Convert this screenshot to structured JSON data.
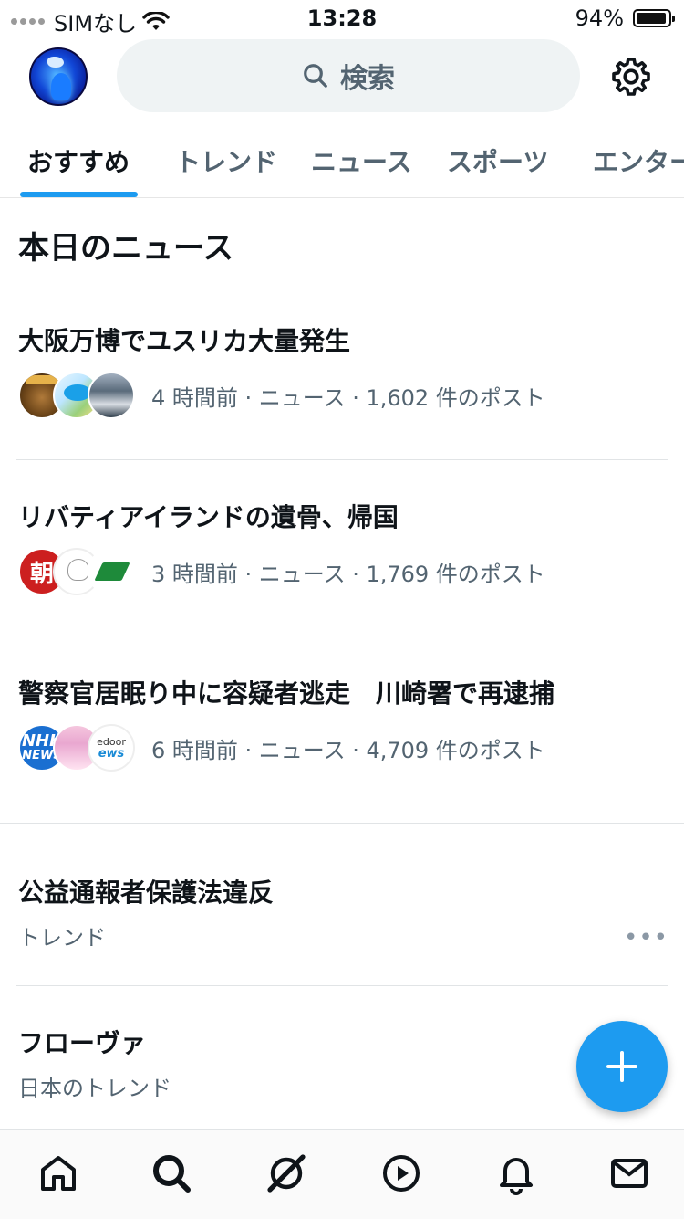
{
  "status_bar": {
    "carrier": "SIMなし",
    "time": "13:28",
    "battery_text": "94%",
    "battery_level": 0.94
  },
  "header": {
    "search_placeholder": "検索"
  },
  "tabs": [
    {
      "label": "おすすめ",
      "active": true
    },
    {
      "label": "トレンド"
    },
    {
      "label": "ニュース"
    },
    {
      "label": "スポーツ"
    },
    {
      "label": "エンター"
    }
  ],
  "section_title": "本日のニュース",
  "news": [
    {
      "title": "大阪万博でユスリカ大量発生",
      "meta": "4 時間前 · ニュース · 1,602 件のポスト"
    },
    {
      "title": "リバティアイランドの遺骨、帰国",
      "meta": "3 時間前 · ニュース · 1,769 件のポスト",
      "avatar_text": "朝"
    },
    {
      "title": "警察官居眠り中に容疑者逃走　川崎署で再逮捕",
      "meta": "6 時間前 · ニュース · 4,709 件のポスト",
      "nhk_line1": "NHK",
      "nhk_line2": "NEWS",
      "livedoor_line1": "edoor",
      "livedoor_line2": "ews"
    }
  ],
  "trends": [
    {
      "title": "公益通報者保護法違反",
      "subtitle": "トレンド",
      "more": "•••"
    },
    {
      "title": "フローヴァ",
      "subtitle": "日本のトレンド"
    }
  ],
  "colors": {
    "accent": "#1d9bf0",
    "text": "#0f1419",
    "secondary": "#536471"
  },
  "icons": {
    "header": [
      "profile-avatar",
      "search-icon",
      "gear-icon"
    ],
    "bottom_nav": [
      "home-icon",
      "search-icon",
      "grok-icon",
      "video-play-icon",
      "notifications-bell-icon",
      "messages-envelope-icon"
    ],
    "fab": "plus-icon"
  }
}
